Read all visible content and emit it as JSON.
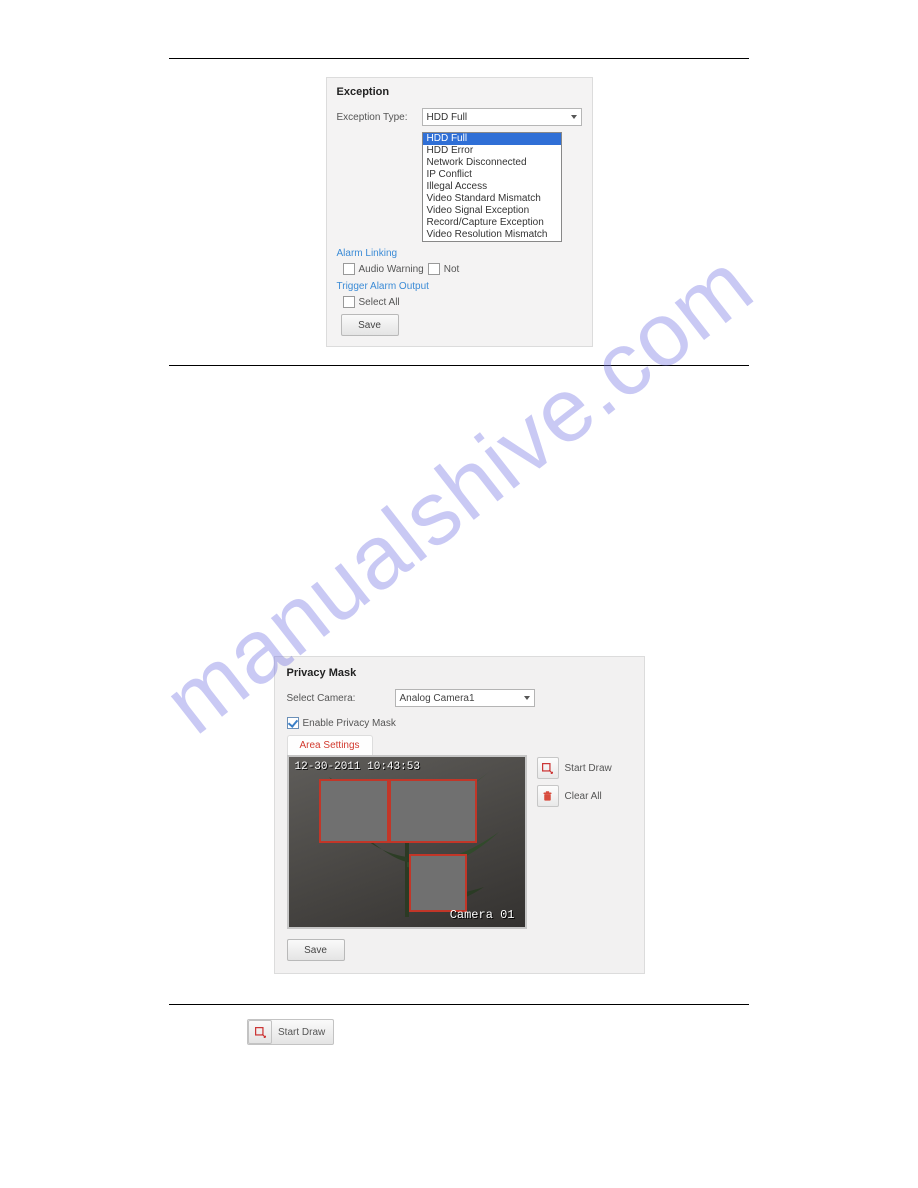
{
  "watermark": "manualshive.com",
  "exception_panel": {
    "title": "Exception",
    "type_label": "Exception Type:",
    "type_value": "HDD Full",
    "options": [
      "HDD Full",
      "HDD Error",
      "Network Disconnected",
      "IP Conflict",
      "Illegal Access",
      "Video Standard Mismatch",
      "Video Signal Exception",
      "Record/Capture Exception",
      "Video Resolution Mismatch"
    ],
    "selected_index": 0,
    "alarm_linking_label": "Alarm Linking",
    "audio_warning_label": "Audio Warning",
    "notify_label": "Not",
    "trigger_alarm_label": "Trigger Alarm Output",
    "select_all_label": "Select All",
    "save_label": "Save"
  },
  "privacy_panel": {
    "title": "Privacy Mask",
    "select_camera_label": "Select Camera:",
    "select_camera_value": "Analog Camera1",
    "enable_label": "Enable Privacy Mask",
    "enable_checked": true,
    "tab_label": "Area Settings",
    "timestamp": "12-30-2011 10:43:53",
    "camera_overlay": "Camera 01",
    "buttons": {
      "start_draw": "Start Draw",
      "clear_all": "Clear All"
    },
    "save_label": "Save"
  },
  "standalone_button_label": "Start Draw"
}
